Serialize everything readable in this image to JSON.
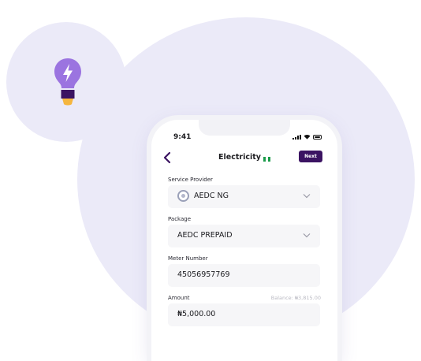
{
  "status_bar": {
    "time": "9:41"
  },
  "header": {
    "title": "Electricity",
    "next_label": "Next"
  },
  "flag_colors": [
    "#1b9b4a",
    "#ffffff",
    "#1b9b4a"
  ],
  "form": {
    "service_provider": {
      "label": "Service Provider",
      "value": "AEDC NG"
    },
    "package": {
      "label": "Package",
      "value": "AEDC PREPAID"
    },
    "meter_number": {
      "label": "Meter Number",
      "value": "45056957769"
    },
    "amount": {
      "label": "Amount",
      "value": "₦5,000.00",
      "balance": "Balance: ₦3,815.00"
    }
  },
  "colors": {
    "accent": "#3b1362",
    "bulb_purple": "#9b74e0",
    "bulb_base": "#3b1362",
    "bulb_tip": "#f5b63f",
    "background_circle": "#ebeaf8"
  },
  "icons": {
    "bulb": "lightbulb-icon",
    "bolt": "lightning-bolt-icon",
    "back": "chevron-left-icon",
    "dropdown": "chevron-down-icon"
  }
}
